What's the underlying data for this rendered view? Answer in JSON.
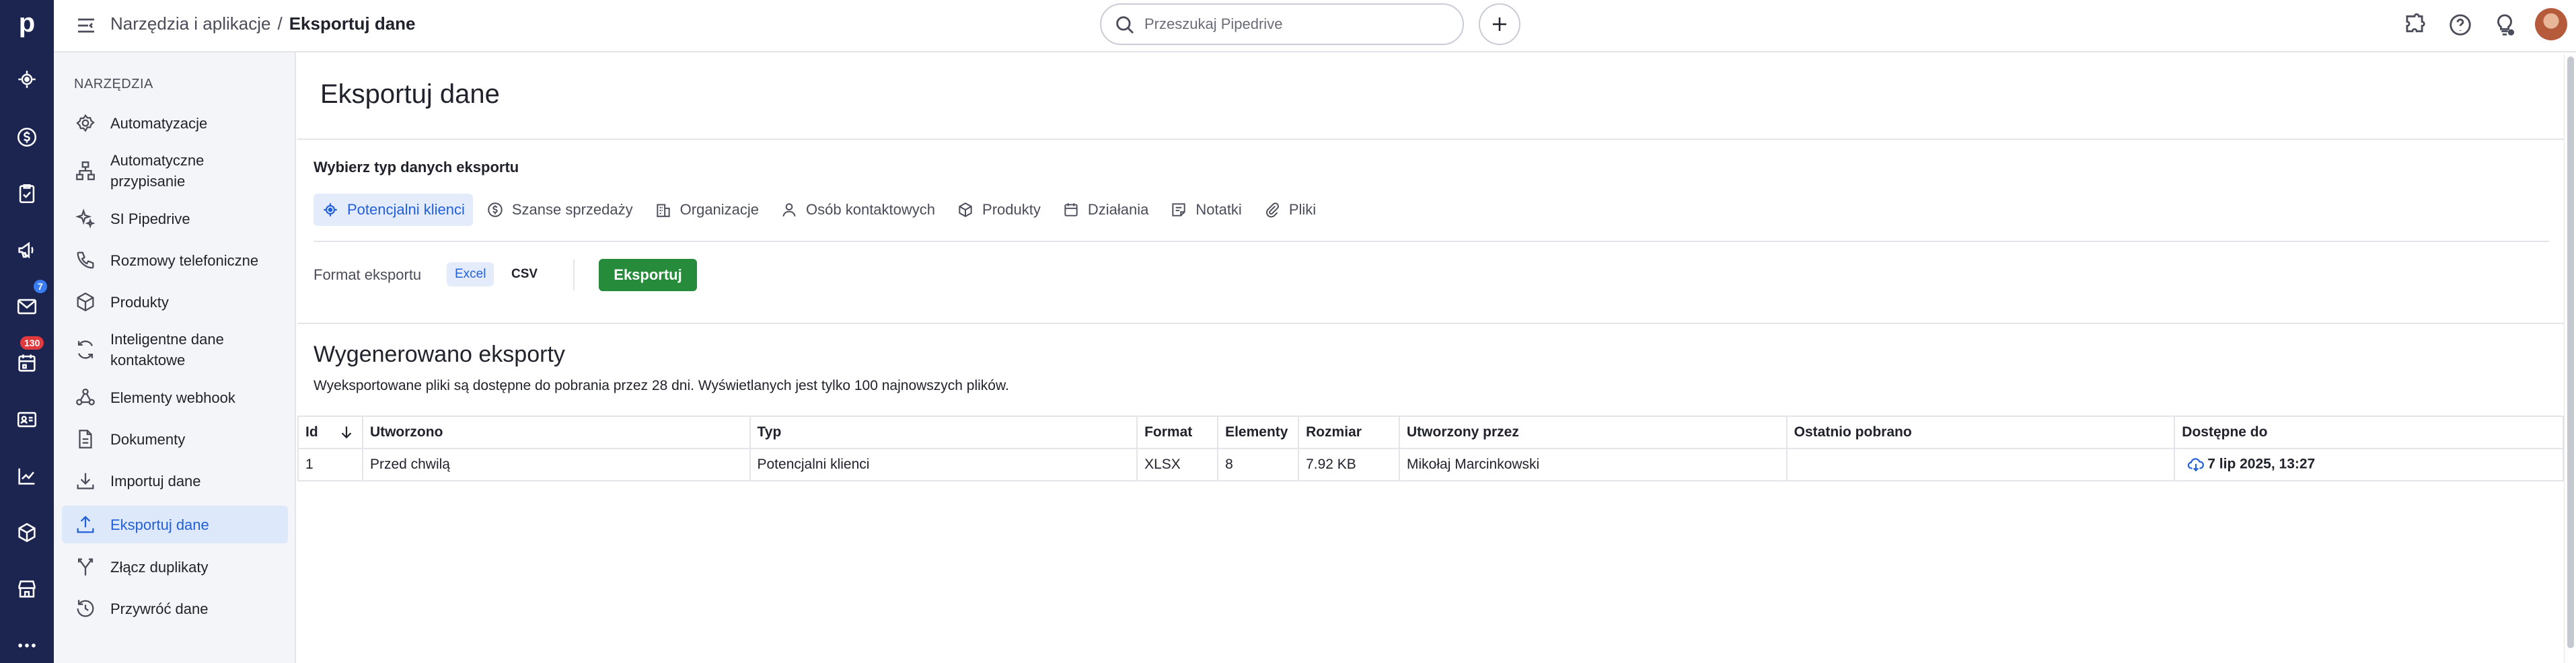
{
  "rail": {
    "logo": "p",
    "badges": {
      "mail": "7",
      "activities": "130"
    }
  },
  "header": {
    "breadcrumb_parent": "Narzędzia i aplikacje",
    "breadcrumb_separator": "/",
    "breadcrumb_current": "Eksportuj dane",
    "search_placeholder": "Przeszukaj Pipedrive"
  },
  "sidebar": {
    "section_title": "NARZĘDZIA",
    "items": [
      {
        "label": "Automatyzacje",
        "icon": "automation-icon"
      },
      {
        "label": "Automatyczne przypisanie",
        "icon": "assignment-icon"
      },
      {
        "label": "SI Pipedrive",
        "icon": "sparkle-icon"
      },
      {
        "label": "Rozmowy telefoniczne",
        "icon": "phone-icon"
      },
      {
        "label": "Produkty",
        "icon": "box-icon"
      },
      {
        "label": "Inteligentne dane kontaktowe",
        "icon": "sync-icon"
      },
      {
        "label": "Elementy webhook",
        "icon": "webhook-icon"
      },
      {
        "label": "Dokumenty",
        "icon": "document-icon"
      },
      {
        "label": "Importuj dane",
        "icon": "import-icon"
      },
      {
        "label": "Eksportuj dane",
        "icon": "export-icon",
        "active": true
      },
      {
        "label": "Złącz duplikaty",
        "icon": "merge-icon"
      },
      {
        "label": "Przywróć dane",
        "icon": "restore-icon"
      }
    ]
  },
  "main": {
    "title": "Eksportuj dane",
    "choose_label": "Wybierz typ danych eksportu",
    "tabs": [
      {
        "label": "Potencjalni klienci",
        "icon": "lead-icon",
        "active": true
      },
      {
        "label": "Szanse sprzedaży",
        "icon": "deal-icon"
      },
      {
        "label": "Organizacje",
        "icon": "building-icon"
      },
      {
        "label": "Osób kontaktowych",
        "icon": "person-icon"
      },
      {
        "label": "Produkty",
        "icon": "box-icon"
      },
      {
        "label": "Działania",
        "icon": "calendar-icon"
      },
      {
        "label": "Notatki",
        "icon": "note-icon"
      },
      {
        "label": "Pliki",
        "icon": "paperclip-icon"
      }
    ],
    "format_label": "Format eksportu",
    "format_options": [
      "Excel",
      "CSV"
    ],
    "selected_format": "Excel",
    "export_button": "Eksportuj",
    "generated_title": "Wygenerowano eksporty",
    "generated_subtitle": "Wyeksportowane pliki są dostępne do pobrania przez 28 dni. Wyświetlanych jest tylko 100 najnowszych plików."
  },
  "table": {
    "columns": [
      "Id",
      "Utworzono",
      "Typ",
      "Format",
      "Elementy",
      "Rozmiar",
      "Utworzony przez",
      "Ostatnio pobrano",
      "Dostępne do"
    ],
    "rows": [
      [
        "1",
        "Przed chwilą",
        "Potencjalni klienci",
        "XLSX",
        "8",
        "7.92 KB",
        "Mikołaj Marcinkowski",
        "",
        "7 lip 2025, 13:27"
      ]
    ]
  },
  "colors": {
    "rail_bg": "#1b2550",
    "accent_blue": "#2260d9",
    "export_green": "#268b3b",
    "badge_red": "#e0393e",
    "badge_blue": "#3a7cf2"
  }
}
